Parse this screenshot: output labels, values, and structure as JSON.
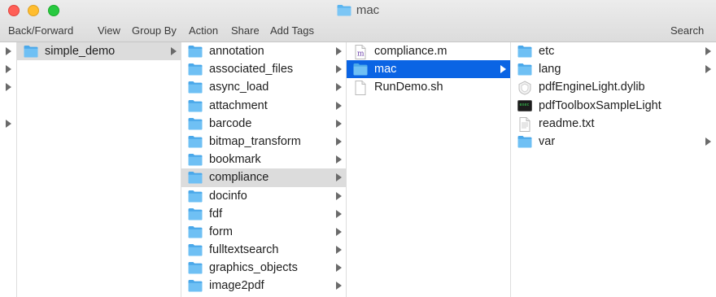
{
  "window": {
    "title": "mac"
  },
  "toolbar": {
    "back_forward": "Back/Forward",
    "view": "View",
    "group_by": "Group By",
    "action": "Action",
    "share": "Share",
    "add_tags": "Add Tags",
    "search": "Search"
  },
  "colors": {
    "folder": "#5ab4ef",
    "selection_blue": "#0a64e4",
    "selection_gray": "#dcdcdc"
  },
  "columns": [
    {
      "items": [
        {
          "label": "",
          "icon": "none",
          "has_children": true
        },
        {
          "label": "",
          "icon": "none",
          "has_children": true
        },
        {
          "label": "",
          "icon": "none",
          "has_children": true
        },
        {
          "label": "",
          "icon": "none",
          "has_children": false
        },
        {
          "label": "",
          "icon": "none",
          "has_children": true
        }
      ]
    },
    {
      "items": [
        {
          "label": "simple_demo",
          "icon": "folder-icon",
          "has_children": true,
          "selected": "gray"
        }
      ]
    },
    {
      "items": [
        {
          "label": "annotation",
          "icon": "folder-icon",
          "has_children": true
        },
        {
          "label": "associated_files",
          "icon": "folder-icon",
          "has_children": true
        },
        {
          "label": "async_load",
          "icon": "folder-icon",
          "has_children": true
        },
        {
          "label": "attachment",
          "icon": "folder-icon",
          "has_children": true
        },
        {
          "label": "barcode",
          "icon": "folder-icon",
          "has_children": true
        },
        {
          "label": "bitmap_transform",
          "icon": "folder-icon",
          "has_children": true
        },
        {
          "label": "bookmark",
          "icon": "folder-icon",
          "has_children": true
        },
        {
          "label": "compliance",
          "icon": "folder-icon",
          "has_children": true,
          "selected": "gray"
        },
        {
          "label": "docinfo",
          "icon": "folder-icon",
          "has_children": true
        },
        {
          "label": "fdf",
          "icon": "folder-icon",
          "has_children": true
        },
        {
          "label": "form",
          "icon": "folder-icon",
          "has_children": true
        },
        {
          "label": "fulltextsearch",
          "icon": "folder-icon",
          "has_children": true
        },
        {
          "label": "graphics_objects",
          "icon": "folder-icon",
          "has_children": true
        },
        {
          "label": "image2pdf",
          "icon": "folder-icon",
          "has_children": true
        }
      ]
    },
    {
      "items": [
        {
          "label": "compliance.m",
          "icon": "objc-file-icon",
          "has_children": false
        },
        {
          "label": "mac",
          "icon": "folder-icon",
          "has_children": true,
          "selected": "blue"
        },
        {
          "label": "RunDemo.sh",
          "icon": "document-icon",
          "has_children": false
        }
      ]
    },
    {
      "items": [
        {
          "label": "etc",
          "icon": "folder-icon",
          "has_children": true
        },
        {
          "label": "lang",
          "icon": "folder-icon",
          "has_children": true
        },
        {
          "label": "pdfEngineLight.dylib",
          "icon": "library-icon",
          "has_children": false
        },
        {
          "label": "pdfToolboxSampleLight",
          "icon": "terminal-executable-icon",
          "has_children": false
        },
        {
          "label": "readme.txt",
          "icon": "text-document-icon",
          "has_children": false
        },
        {
          "label": "var",
          "icon": "folder-icon",
          "has_children": true
        }
      ]
    }
  ]
}
